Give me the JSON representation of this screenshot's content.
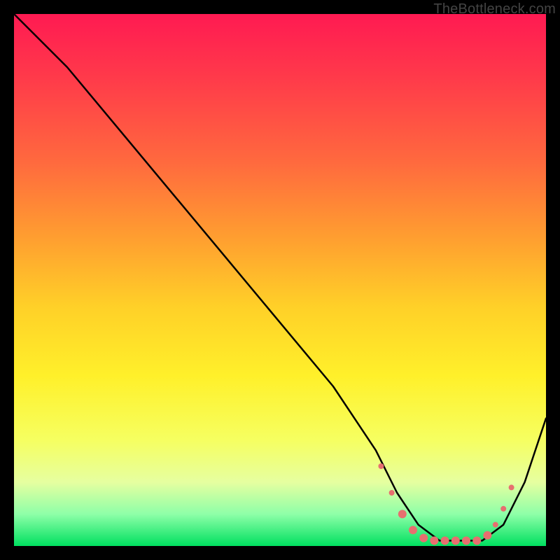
{
  "watermark": "TheBottleneck.com",
  "chart_data": {
    "type": "line",
    "title": "",
    "xlabel": "",
    "ylabel": "",
    "xlim": [
      0,
      100
    ],
    "ylim": [
      0,
      100
    ],
    "grid": false,
    "legend": false,
    "series": [
      {
        "name": "bottleneck-curve",
        "color": "#000000",
        "x": [
          0,
          4,
          10,
          20,
          30,
          40,
          50,
          60,
          68,
          72,
          76,
          80,
          84,
          88,
          92,
          96,
          100
        ],
        "y": [
          100,
          96,
          90,
          78,
          66,
          54,
          42,
          30,
          18,
          10,
          4,
          1,
          1,
          1,
          4,
          12,
          24
        ]
      }
    ],
    "markers": {
      "name": "highlight-dots",
      "color": "#e76f6f",
      "radius_small": 4,
      "radius_large": 6,
      "points": [
        {
          "x": 69,
          "y": 15,
          "r": "small"
        },
        {
          "x": 71,
          "y": 10,
          "r": "small"
        },
        {
          "x": 73,
          "y": 6,
          "r": "large"
        },
        {
          "x": 75,
          "y": 3,
          "r": "large"
        },
        {
          "x": 77,
          "y": 1.5,
          "r": "large"
        },
        {
          "x": 79,
          "y": 1,
          "r": "large"
        },
        {
          "x": 81,
          "y": 1,
          "r": "large"
        },
        {
          "x": 83,
          "y": 1,
          "r": "large"
        },
        {
          "x": 85,
          "y": 1,
          "r": "large"
        },
        {
          "x": 87,
          "y": 1,
          "r": "large"
        },
        {
          "x": 89,
          "y": 2,
          "r": "large"
        },
        {
          "x": 90.5,
          "y": 4,
          "r": "small"
        },
        {
          "x": 92,
          "y": 7,
          "r": "small"
        },
        {
          "x": 93.5,
          "y": 11,
          "r": "small"
        }
      ]
    }
  }
}
